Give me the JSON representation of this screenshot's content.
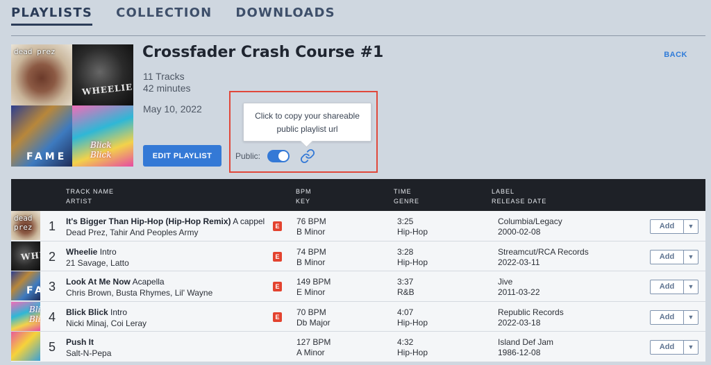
{
  "nav": {
    "tabs": [
      {
        "label": "PLAYLISTS",
        "active": true
      },
      {
        "label": "COLLECTION",
        "active": false
      },
      {
        "label": "DOWNLOADS",
        "active": false
      }
    ]
  },
  "playlist": {
    "title": "Crossfader Crash Course #1",
    "tracks": "11 Tracks",
    "duration": "42 minutes",
    "date": "May 10, 2022",
    "edit_label": "EDIT PLAYLIST",
    "back_label": "BACK",
    "public_label": "Public:",
    "public_on": true,
    "tooltip_line1": "Click to copy your shareable",
    "tooltip_line2": "public playlist url"
  },
  "table": {
    "headers": {
      "track_name": "TRACK NAME",
      "artist": "ARTIST",
      "bpm": "BPM",
      "key": "KEY",
      "time": "TIME",
      "genre": "GENRE",
      "label": "LABEL",
      "release_date": "RELEASE DATE"
    },
    "add_label": "Add",
    "rows": [
      {
        "num": "1",
        "title": "It's Bigger Than Hip-Hop (Hip-Hop Remix)",
        "version": "A cappella",
        "artist": "Dead Prez, Tahir And Peoples Army",
        "explicit": "E",
        "bpm": "76 BPM",
        "key": "B Minor",
        "time": "3:25",
        "genre": "Hip-Hop",
        "label": "Columbia/Legacy",
        "release": "2000-02-08"
      },
      {
        "num": "2",
        "title": "Wheelie",
        "version": "Intro",
        "artist": "21 Savage, Latto",
        "explicit": "E",
        "bpm": "74 BPM",
        "key": "B Minor",
        "time": "3:28",
        "genre": "Hip-Hop",
        "label": "Streamcut/RCA Records",
        "release": "2022-03-11"
      },
      {
        "num": "3",
        "title": "Look At Me Now",
        "version": "Acapella",
        "artist": "Chris Brown, Busta Rhymes, Lil' Wayne",
        "explicit": "E",
        "bpm": "149 BPM",
        "key": "E Minor",
        "time": "3:37",
        "genre": "R&B",
        "label": "Jive",
        "release": "2011-03-22"
      },
      {
        "num": "4",
        "title": "Blick Blick",
        "version": "Intro",
        "artist": "Nicki Minaj, Coi Leray",
        "explicit": "E",
        "bpm": "70 BPM",
        "key": "Db Major",
        "time": "4:07",
        "genre": "Hip-Hop",
        "label": "Republic Records",
        "release": "2022-03-18"
      },
      {
        "num": "5",
        "title": "Push It",
        "version": "",
        "artist": "Salt-N-Pepa",
        "explicit": "",
        "bpm": "127 BPM",
        "key": "A Minor",
        "time": "4:32",
        "genre": "Hip-Hop",
        "label": "Island Def Jam",
        "release": "1986-12-08"
      }
    ]
  }
}
